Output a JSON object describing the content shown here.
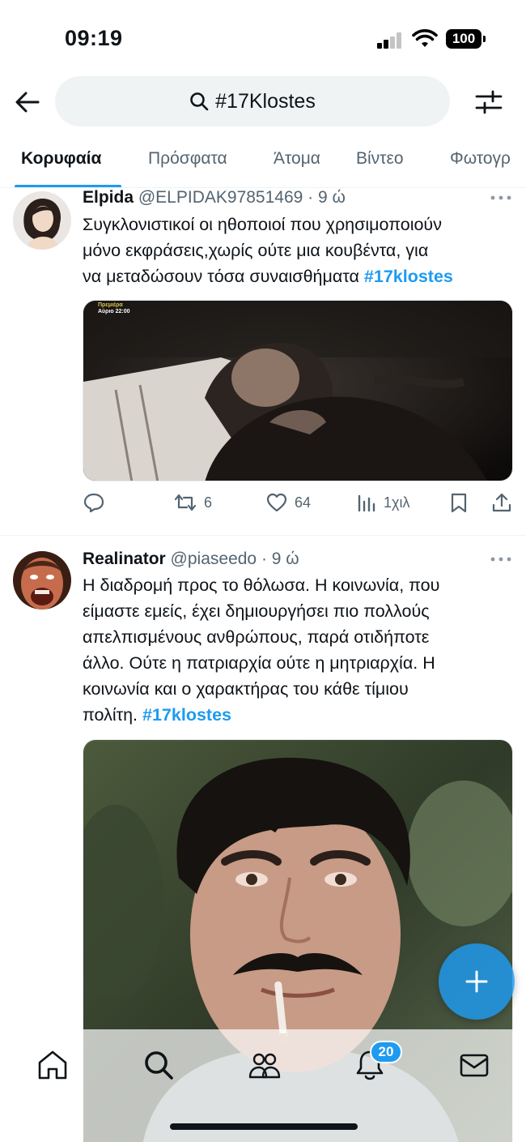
{
  "status_bar": {
    "time": "09:19",
    "battery": "100"
  },
  "search": {
    "query": "#17Klostes"
  },
  "tabs": [
    {
      "label": "Κορυφαία",
      "active": true
    },
    {
      "label": "Πρόσφατα"
    },
    {
      "label": "Άτομα"
    },
    {
      "label": "Βίντεο"
    },
    {
      "label": "Φωτογρ"
    }
  ],
  "tweets": [
    {
      "name": "Elpida",
      "handle": "@ELPIDAK97851469",
      "time": "· 9 ώ",
      "text_lines": [
        "Συγκλονιστικοί οι ηθοποιοί που χρησιμοποιούν",
        "μόνο εκφράσεις,χωρίς ούτε μια κουβέντα, για",
        "να μεταδώσουν τόσα συναισθήματα "
      ],
      "hashtag": "#17klostes",
      "media_overlay": {
        "line1": "Πρεμιέρα",
        "line2": "Αύριο 22:00"
      },
      "actions": {
        "reply": "",
        "retweets": "6",
        "likes": "64",
        "views": "1χιλ"
      }
    },
    {
      "name": "Realinator",
      "handle": "@piaseedo",
      "time": "· 9 ώ",
      "text_lines": [
        "Η διαδρομή προς το θόλωσα. Η κοινωνία, που",
        "είμαστε εμείς, έχει δημιουργήσει πιο πολλούς",
        "απελπισμένους ανθρώπους, παρά οτιδήποτε",
        "άλλο. Ούτε η πατριαρχία ούτε η μητριαρχία. Η",
        "κοινωνία και ο χαρακτήρας του κάθε τίμιου",
        "πολίτη. "
      ],
      "hashtag": "#17klostes"
    }
  ],
  "bottom_nav": {
    "notifications_badge": "20"
  },
  "colors": {
    "accent": "#1d9bf0",
    "text": "#0f1419",
    "secondary": "#536471"
  }
}
